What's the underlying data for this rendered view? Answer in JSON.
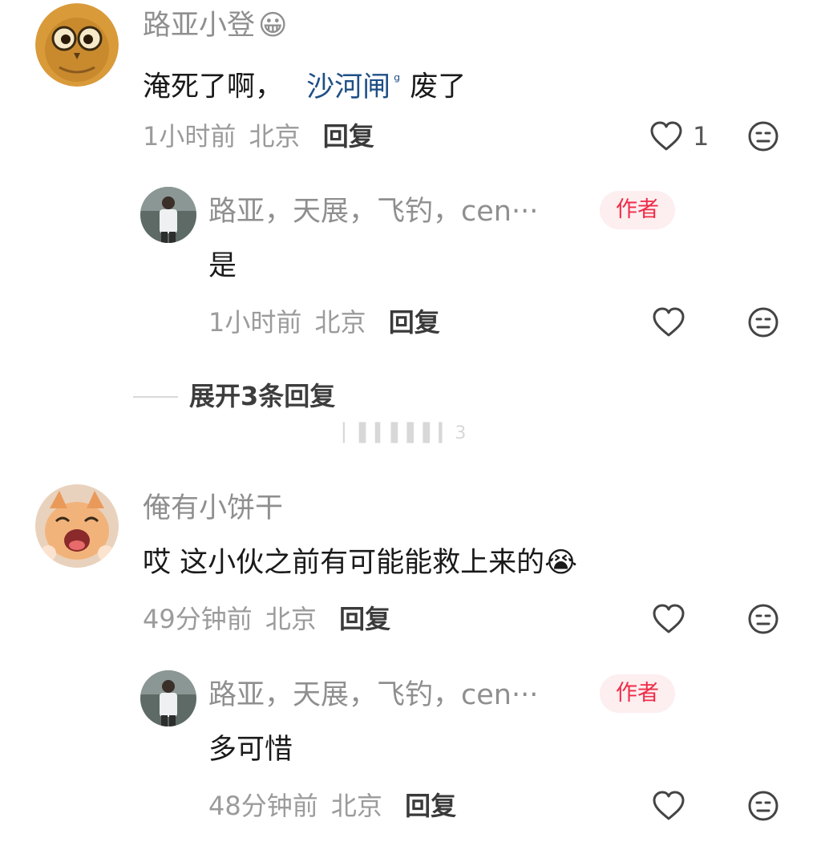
{
  "comments": [
    {
      "author": "路亚小登",
      "author_emoji": "😀",
      "text_before": "淹死了啊，",
      "link_text": "沙河闸",
      "link_sup": "ᵍ",
      "text_after": "废了",
      "time": "1小时前",
      "location": "北京",
      "reply_label": "回复",
      "like_count": "1",
      "replies": [
        {
          "author": "路亚，天展，飞钓，cen···",
          "badge": "作者",
          "text": "是",
          "time": "1小时前",
          "location": "北京",
          "reply_label": "回复"
        }
      ],
      "expand_label": "展开3条回复"
    },
    {
      "author": "俺有小饼干",
      "text": "哎 这小伙之前有可能能救上来的",
      "text_emoji": "😭",
      "time": "49分钟前",
      "location": "北京",
      "reply_label": "回复",
      "replies": [
        {
          "author": "路亚，天展，飞钓，cen···",
          "badge": "作者",
          "text": "多可惜",
          "time": "48分钟前",
          "location": "北京",
          "reply_label": "回复"
        }
      ]
    }
  ],
  "faint_text": "▏▌▍▌▌▌▎3",
  "colors": {
    "badge_bg": "#fdeef0",
    "badge_text": "#ee2d49",
    "link": "#1f4f86",
    "meta": "#9b9b9b"
  },
  "icons": {
    "like": "heart-outline-icon",
    "dislike": "neutral-face-icon"
  }
}
